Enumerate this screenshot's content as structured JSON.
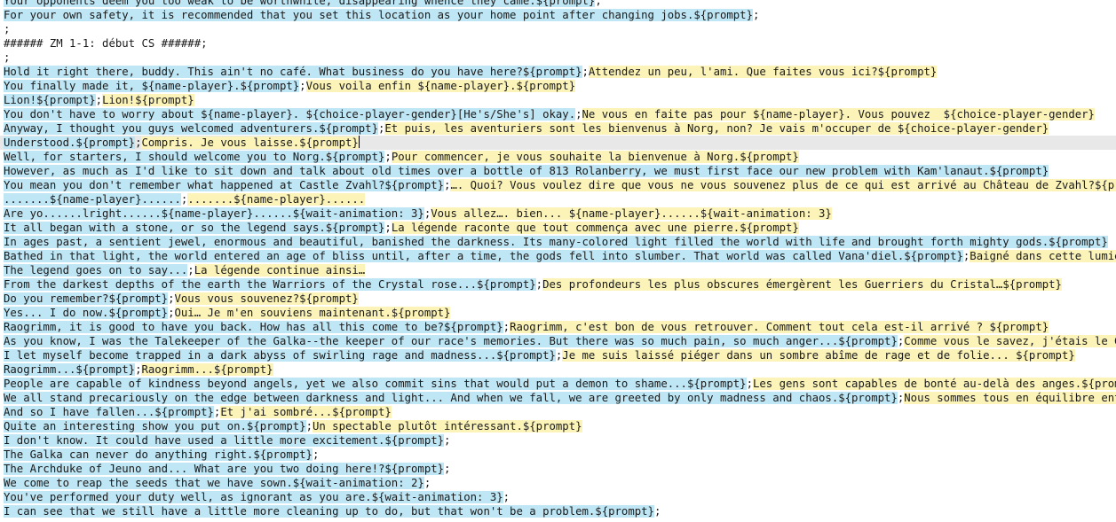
{
  "colors": {
    "source_highlight": "#bfe6f5",
    "translation_highlight": "#fbf3b8",
    "current_line": "#e8e8e8"
  },
  "lines": [
    {
      "en": "Your opponents deem you too weak to be worthwhile, disappearing whence they came.${prompt}",
      "tail": ";"
    },
    {
      "en": "For your own safety, it is recommended that you set this location as your home point after changing jobs.${prompt}",
      "tail": ";"
    },
    {
      "plain": ";"
    },
    {
      "plain": "###### ZM 1-1: début CS ######;"
    },
    {
      "plain": ";"
    },
    {
      "en": "Hold it right there, buddy. This ain't no café. What business do you have here?${prompt}",
      "tail": ";",
      "fr": "Attendez un peu, l'ami. Que faites vous ici?${prompt}"
    },
    {
      "en": "You finally made it, ${name-player}.${prompt}",
      "tail": ";",
      "fr": "Vous voila enfin ${name-player}.${prompt}"
    },
    {
      "en": "Lion!${prompt}",
      "tail": ";",
      "fr": "Lion!${prompt}"
    },
    {
      "en": "You don't have to worry about ${name-player}. ${choice-player-gender}[He's/She's] okay.",
      "tail": ";",
      "fr": "Ne vous en faite pas pour ${name-player}. Vous pouvez  ${choice-player-gender}"
    },
    {
      "en": "Anyway, I thought you guys welcomed adventurers.${prompt}",
      "tail": ";",
      "fr": "Et puis, les aventuriers sont les bienvenus à Norg, non? Je vais m'occuper de ${choice-player-gender}"
    },
    {
      "en": "Understood.${prompt}",
      "tail": ";",
      "fr": "Compris. Je vous laisse.${prompt}",
      "current": true
    },
    {
      "en": "Well, for starters, I should welcome you to Norg.${prompt}",
      "tail": ";",
      "fr": "Pour commencer, je vous souhaite la bienvenue à Norg.${prompt}"
    },
    {
      "en": "However, as much as I'd like to sit down and talk about old times over a bottle of 813 Rolanberry, we must first face our new problem with Kam'lanaut.${prompt}",
      "tail": ""
    },
    {
      "en": "You mean you don't remember what happened at Castle Zvahl?${prompt}",
      "tail": ";",
      "fr": "…. Quoi? Vous voulez dire que vous ne vous souvenez plus de ce qui est arrivé au Château de Zvahl?${prompt}"
    },
    {
      "en": ".......${name-player}......",
      "tail": ";",
      "fr": ".......${name-player}......"
    },
    {
      "en": "Are yo......lright......${name-player}......${wait-animation: 3}",
      "tail": ";",
      "fr": "Vous allez…. bien... ${name-player}......${wait-animation: 3}"
    },
    {
      "en": "It all began with a stone, or so the legend says.${prompt}",
      "tail": ";",
      "fr": "La légende raconte que tout commença avec une pierre.${prompt}"
    },
    {
      "en": "In ages past, a sentient jewel, enormous and beautiful, banished the darkness. Its many-colored light filled the world with life and brought forth mighty gods.${prompt}",
      "tail": ""
    },
    {
      "en": "Bathed in that light, the world entered an age of bliss until, after a time, the gods fell into slumber. That world was called Vana'diel.${prompt}",
      "tail": ";",
      "fr": "Baigné dans cette lumière, le monde entra dans un âge de bonheur.${prompt}"
    },
    {
      "en": "The legend goes on to say...",
      "tail": ";",
      "fr": "La légende continue ainsi…"
    },
    {
      "en": "From the darkest depths of the earth the Warriors of the Crystal rose...${prompt}",
      "tail": ";",
      "fr": "Des profondeurs les plus obscures émergèrent les Guerriers du Cristal…${prompt}"
    },
    {
      "en": "Do you remember?${prompt}",
      "tail": ";",
      "fr": "Vous vous souvenez?${prompt}"
    },
    {
      "en": "Yes... I do now.${prompt}",
      "tail": ";",
      "fr": "Oui… Je m'en souviens maintenant.${prompt}"
    },
    {
      "en": "Raogrimm, it is good to have you back. How has all this come to be?${prompt}",
      "tail": ";",
      "fr": "Raogrimm, c'est bon de vous retrouver. Comment tout cela est-il arrivé ? ${prompt}"
    },
    {
      "en": "As you know, I was the Talekeeper of the Galka--the keeper of our race's memories. But there was so much pain, so much anger...${prompt}",
      "tail": ";",
      "fr": "Comme vous le savez, j'étais le Gardien des Mémoires des Galka.${prompt}"
    },
    {
      "en": "I let myself become trapped in a dark abyss of swirling rage and madness...${prompt}",
      "tail": ";",
      "fr": "Je me suis laissé piéger dans un sombre abîme de rage et de folie... ${prompt}"
    },
    {
      "en": "Raogrimm...${prompt}",
      "tail": ";",
      "fr": "Raogrimm...${prompt}"
    },
    {
      "en": "People are capable of kindness beyond angels, yet we also commit sins that would put a demon to shame...${prompt}",
      "tail": ";",
      "fr": "Les gens sont capables de bonté au-delà des anges.${prompt}"
    },
    {
      "en": "We all stand precariously on the edge between darkness and light... And when we fall, we are greeted by only madness and chaos.${prompt}",
      "tail": ";",
      "fr": "Nous sommes tous en équilibre entre les ténèbres et la lumière.${prompt}"
    },
    {
      "en": "And so I have fallen...${prompt}",
      "tail": ";",
      "fr": "Et j'ai sombré...${prompt}"
    },
    {
      "en": "Quite an interesting show you put on.${prompt}",
      "tail": ";",
      "fr": "Un spectable plutôt intéressant.${prompt}"
    },
    {
      "en": "I don't know. It could have used a little more excitement.${prompt}",
      "tail": ";"
    },
    {
      "en": "The Galka can never do anything right.${prompt}",
      "tail": ";"
    },
    {
      "en": "The Archduke of Jeuno and... What are you two doing here!?${prompt}",
      "tail": ";"
    },
    {
      "en": "We come to reap the seeds that we have sown.${wait-animation: 2}",
      "tail": ";"
    },
    {
      "en": "You've performed your duty well, as ignorant as you are.${wait-animation: 3}",
      "tail": ";"
    },
    {
      "en": "I can see that we still have a little more cleaning up to do, but that won't be a problem.${prompt}",
      "tail": ";"
    }
  ]
}
